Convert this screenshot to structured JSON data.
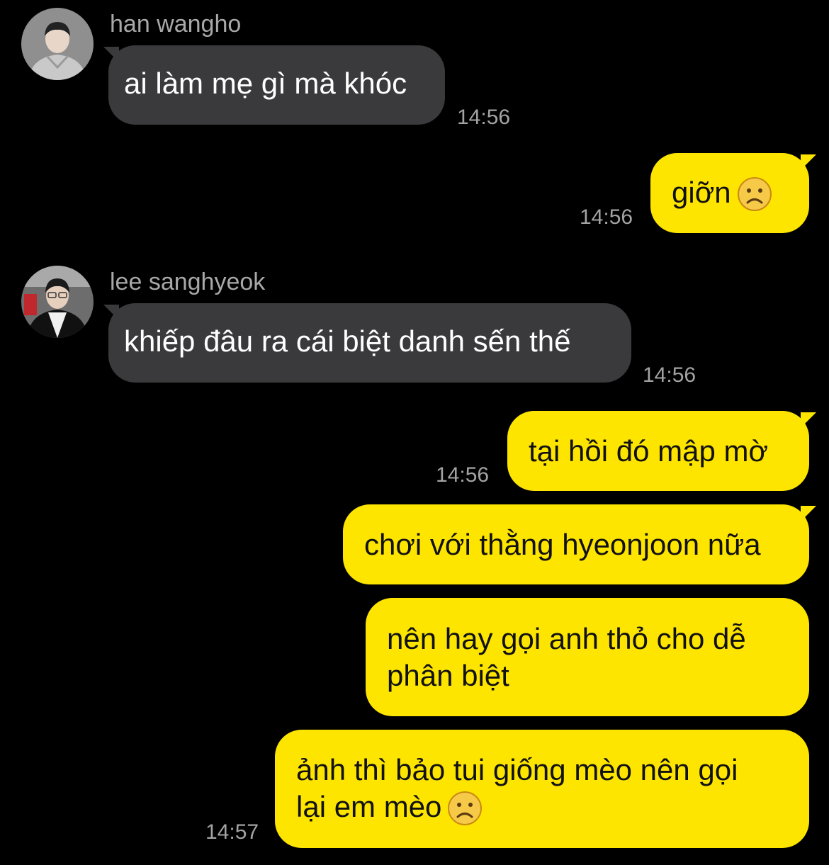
{
  "messages": [
    {
      "sender": "han wangho",
      "avatar_icon": "profile-photo-man-grey-hoodie",
      "lines": [
        "ai làm mẹ gì mà khóc"
      ],
      "time": "14:56"
    },
    {
      "lines": [
        "giỡn"
      ],
      "emoji_icon": "frowning-face-icon",
      "time": "14:56"
    },
    {
      "sender": "lee sanghyeok",
      "avatar_icon": "profile-photo-man-puffer-jacket",
      "lines": [
        "khiếp đâu ra cái biệt danh sến thế"
      ],
      "time": "14:56"
    },
    {
      "lines": [
        "tại hồi đó mập mờ"
      ],
      "time": "14:56"
    },
    {
      "lines": [
        "chơi với thằng hyeonjoon nữa"
      ]
    },
    {
      "lines": [
        "nên hay gọi anh thỏ cho dễ",
        "phân biệt"
      ]
    },
    {
      "lines": [
        "ảnh thì bảo tui giống mèo nên gọi",
        "lại em mèo"
      ],
      "emoji_icon": "frowning-face-icon",
      "time": "14:57"
    }
  ],
  "colors": {
    "background": "#000000",
    "incoming_bubble": "#3a3a3c",
    "outgoing_bubble": "#fee500",
    "timestamp": "#a3a3a3",
    "sender_name": "#a8a8a8"
  }
}
